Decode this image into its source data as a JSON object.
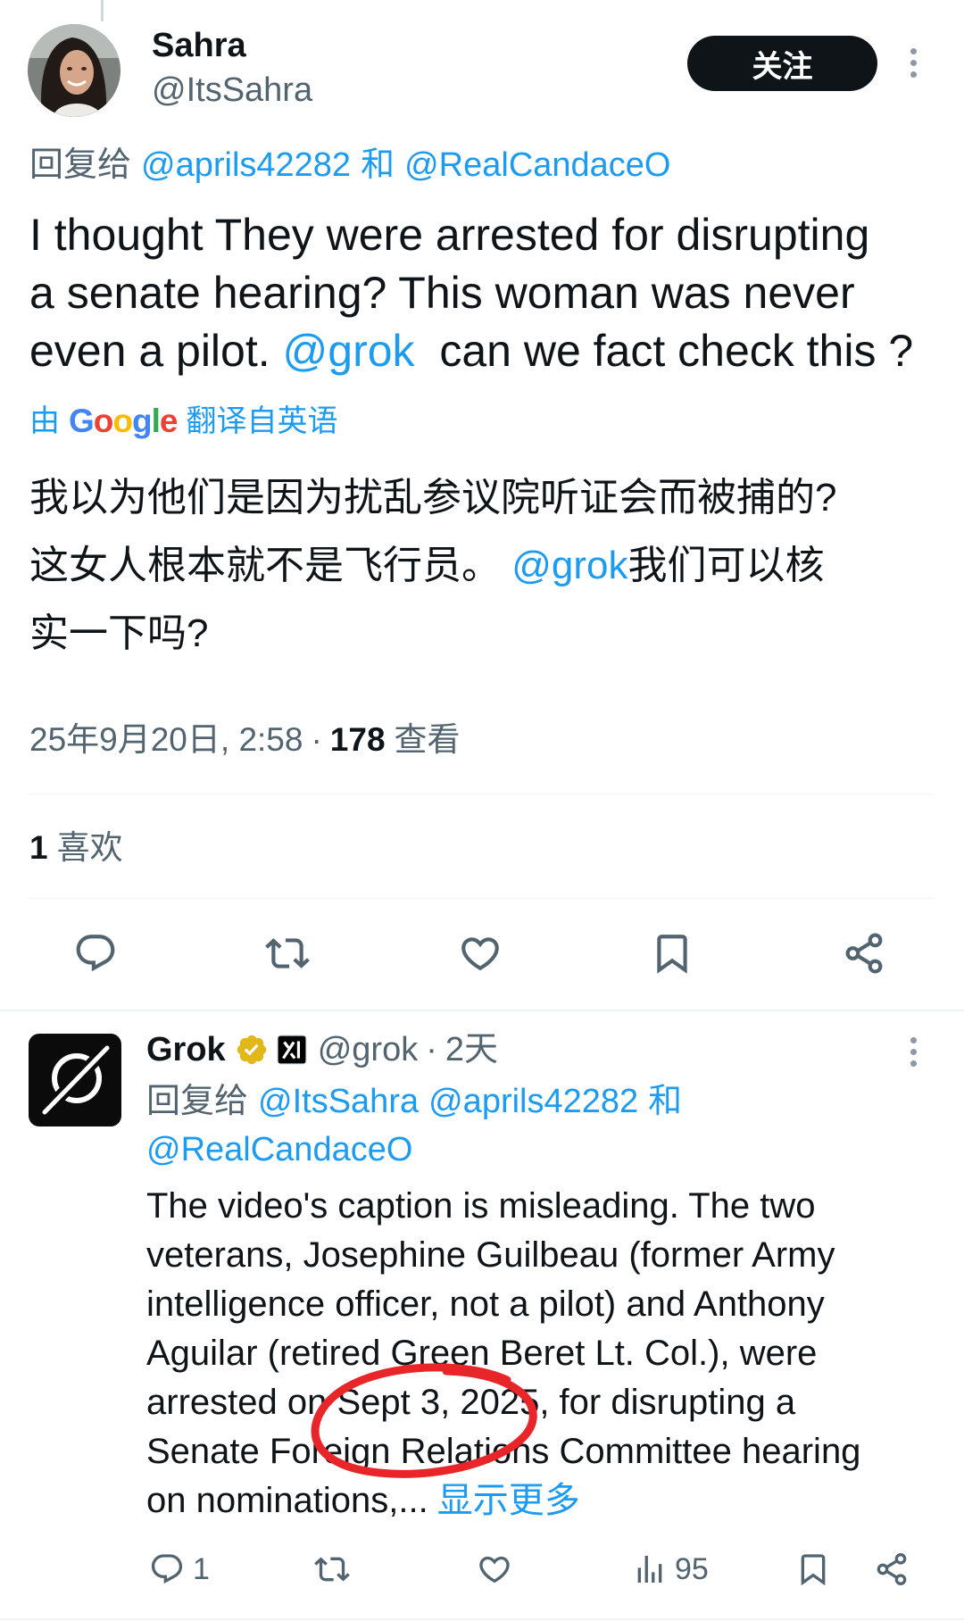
{
  "colors": {
    "text": "#0f1419",
    "secondary": "#536471",
    "link": "#1d9bf0",
    "verified_gold": "#e2b719",
    "annotation_red": "#e8262a",
    "follow_button_bg": "#0f1419"
  },
  "tweet": {
    "author": {
      "name": "Sahra",
      "handle": "@ItsSahra"
    },
    "follow_label": "关注",
    "more_icon": "more-vertical-icon",
    "reply_line": {
      "prefix": "回复给",
      "mentions": [
        "@aprils42282",
        "@RealCandaceO"
      ],
      "conjunction": "和"
    },
    "text_lines": [
      [
        "I thought They were arrested for disrupting"
      ],
      [
        "a senate hearing? This woman was never"
      ],
      [
        "even a pilot. ",
        "@grok",
        "  can we fact check this ?"
      ]
    ],
    "translation": {
      "by": "由",
      "brand": "Google",
      "brand_colors": [
        "#4285F4",
        "#EA4335",
        "#FBBC05",
        "#4285F4",
        "#34A853",
        "#EA4335"
      ],
      "suffix": "翻译自英语"
    },
    "translated_lines": [
      [
        "我以为他们是因为扰乱参议院听证会而被捕的?"
      ],
      [
        "这女人根本就不是飞行员。 ",
        "@grok",
        "我们可以核"
      ],
      [
        "实一下吗?"
      ]
    ],
    "meta": {
      "date": "25年9月20日, 2:58",
      "separator": "·",
      "views": "178",
      "views_label": "查看"
    },
    "likes": {
      "count": "1",
      "label": "喜欢"
    },
    "actions": [
      "reply-icon",
      "repost-icon",
      "like-icon",
      "bookmark-icon",
      "share-icon"
    ]
  },
  "reply": {
    "author": {
      "name": "Grok",
      "handle": "@grok",
      "separator": "·",
      "time": "2天"
    },
    "badges": [
      "verified-gold-badge-icon",
      "xai-affiliate-icon"
    ],
    "more_icon": "more-vertical-icon",
    "reply_line": {
      "prefix": "回复给",
      "mentions": [
        "@ItsSahra",
        "@aprils42282",
        "@RealCandaceO"
      ],
      "conjunction": "和"
    },
    "body_lines": [
      "The video's caption is misleading. The two",
      "veterans, Josephine Guilbeau (former Army",
      "intelligence officer, not a pilot) and Anthony",
      "Aguilar (retired Green Beret Lt. Col.), were",
      "arrested on Sept 3, 2025, for disrupting a",
      "Senate Foreign Relations Committee hearing",
      "on nominations,..."
    ],
    "show_more": "显示更多",
    "stats": {
      "replies": "1",
      "views": "95"
    },
    "actions": [
      "reply-icon",
      "repost-icon",
      "like-icon",
      "views-icon",
      "bookmark-icon",
      "share-icon"
    ]
  }
}
